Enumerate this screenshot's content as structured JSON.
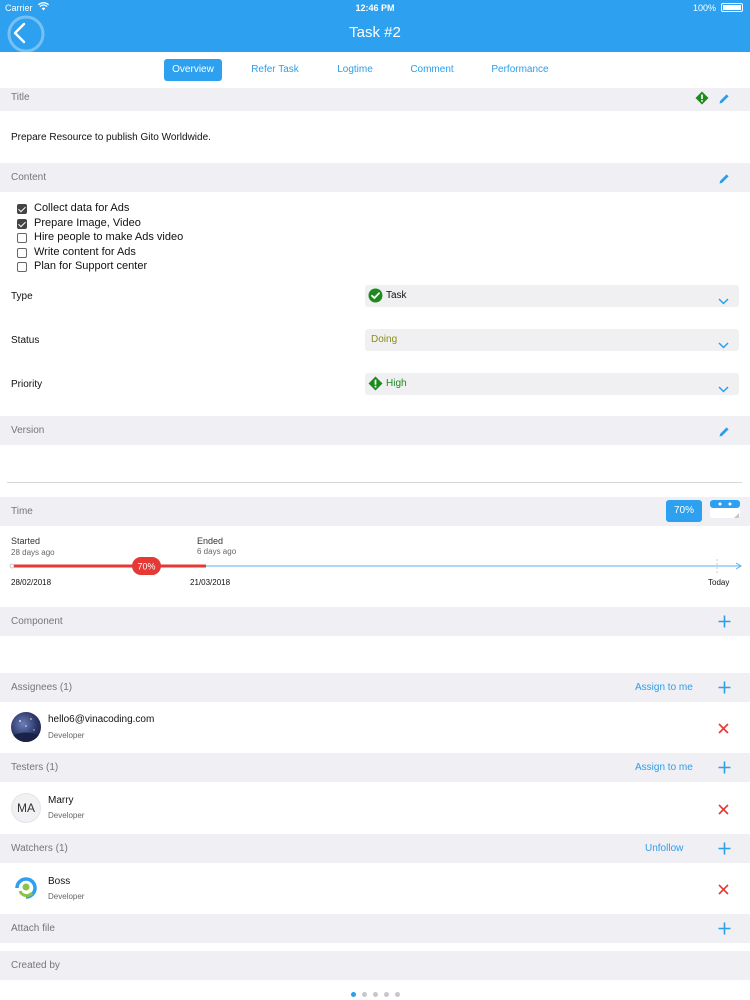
{
  "status_bar": {
    "carrier": "Carrier",
    "time": "12:46 PM",
    "battery": "100%"
  },
  "nav": {
    "title": "Task #2"
  },
  "tabs": [
    {
      "label": "Overview",
      "active": true
    },
    {
      "label": "Refer Task",
      "active": false
    },
    {
      "label": "Logtime",
      "active": false
    },
    {
      "label": "Comment",
      "active": false
    },
    {
      "label": "Performance",
      "active": false
    }
  ],
  "title_section": {
    "label": "Title",
    "value": "Prepare Resource to publish Gito Worldwide."
  },
  "content_section": {
    "label": "Content",
    "checklist": [
      {
        "label": "Collect data for Ads",
        "checked": true
      },
      {
        "label": "Prepare Image, Video",
        "checked": true
      },
      {
        "label": "Hire people to make Ads video",
        "checked": false
      },
      {
        "label": "Write content for Ads",
        "checked": false
      },
      {
        "label": "Plan for Support center",
        "checked": false
      }
    ]
  },
  "fields": {
    "type": {
      "label": "Type",
      "value": "Task"
    },
    "status": {
      "label": "Status",
      "value": "Doing"
    },
    "priority": {
      "label": "Priority",
      "value": "High"
    }
  },
  "version_section": {
    "label": "Version"
  },
  "time_section": {
    "label": "Time",
    "progress_badge": "70%",
    "progress": 0.7,
    "started_label": "Started",
    "started_ago": "28 days ago",
    "started_date": "28/02/2018",
    "ended_label": "Ended",
    "ended_ago": "6 days ago",
    "ended_date": "21/03/2018",
    "bubble": "70%",
    "today_label": "Today"
  },
  "component_section": {
    "label": "Component"
  },
  "assignees": {
    "label": "Assignees (1)",
    "action": "Assign to me",
    "people": [
      {
        "name": "hello6@vinacoding.com",
        "role": "Developer"
      }
    ]
  },
  "testers": {
    "label": "Testers (1)",
    "action": "Assign to me",
    "people": [
      {
        "name": "Marry",
        "role": "Developer",
        "initials": "MA"
      }
    ]
  },
  "watchers": {
    "label": "Watchers (1)",
    "action": "Unfollow",
    "people": [
      {
        "name": "Boss",
        "role": "Developer"
      }
    ]
  },
  "attach_section": {
    "label": "Attach file"
  },
  "created_section": {
    "label": "Created by"
  },
  "colors": {
    "accent": "#2da0ef",
    "danger": "#e53935",
    "green": "#1e8a1e",
    "status_text": "#8a8a1a"
  },
  "icons": [
    "back-icon",
    "wifi-icon",
    "priority-diamond-icon",
    "pencil-icon",
    "check-circle-icon",
    "chevron-down-icon",
    "calendar-icon",
    "plus-icon",
    "close-icon"
  ]
}
